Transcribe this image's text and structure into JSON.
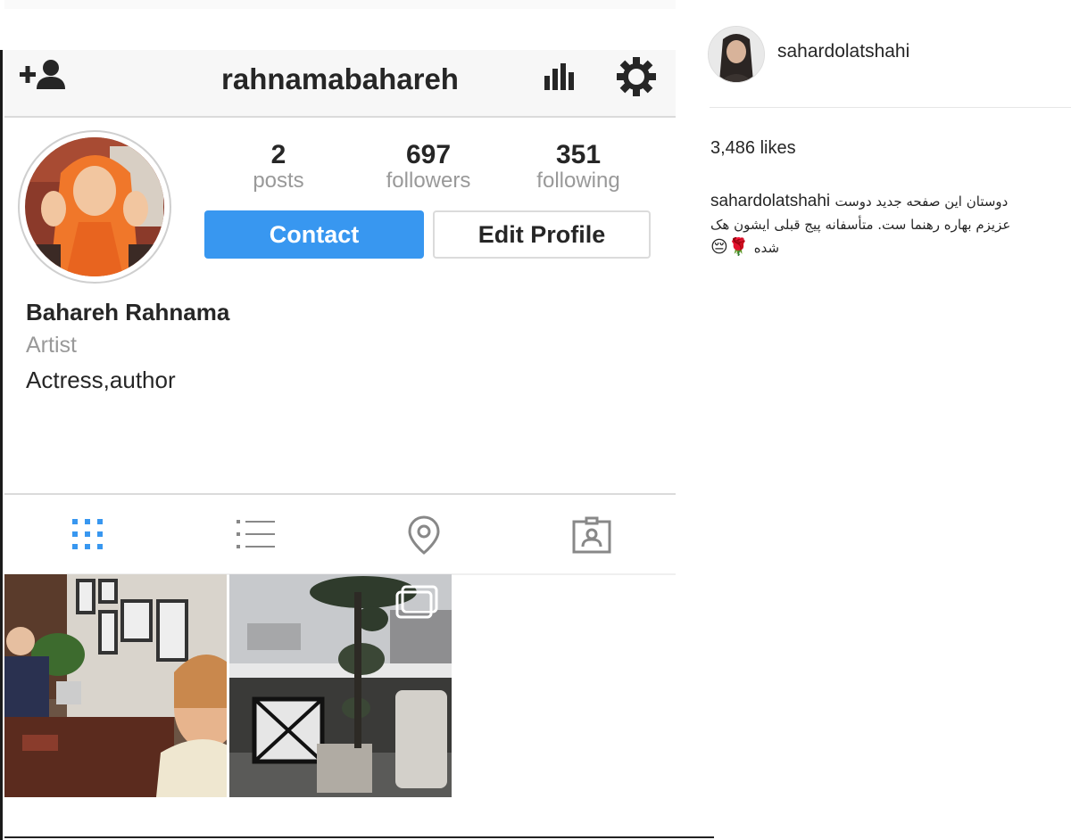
{
  "profile": {
    "username": "rahnamabahareh",
    "name": "Bahareh Rahnama",
    "category": "Artist",
    "bio": "Actress,author",
    "stats": {
      "posts": {
        "value": "2",
        "label": "posts"
      },
      "followers": {
        "value": "697",
        "label": "followers"
      },
      "following": {
        "value": "351",
        "label": "following"
      }
    },
    "buttons": {
      "contact": "Contact",
      "edit": "Edit Profile"
    }
  },
  "header_icons": [
    "add-user-icon",
    "insights-icon",
    "gear-icon"
  ],
  "tabs": [
    "grid-icon",
    "list-icon",
    "location-pin-icon",
    "tagged-icon"
  ],
  "post": {
    "username": "sahardolatshahi",
    "likes": "3,486 likes",
    "caption_user": "sahardolatshahi",
    "caption_line1": "دوستان این صفحه جدید دوست",
    "caption_line2": "عزیزم بهاره رهنما ست. متأسفانه پیج قبلی ایشون هک",
    "caption_line3": "شده",
    "caption_emoji": "😔🌹"
  },
  "colors": {
    "accent": "#3897f0",
    "grid_tab_active": "#3897f0",
    "muted": "#999999"
  }
}
